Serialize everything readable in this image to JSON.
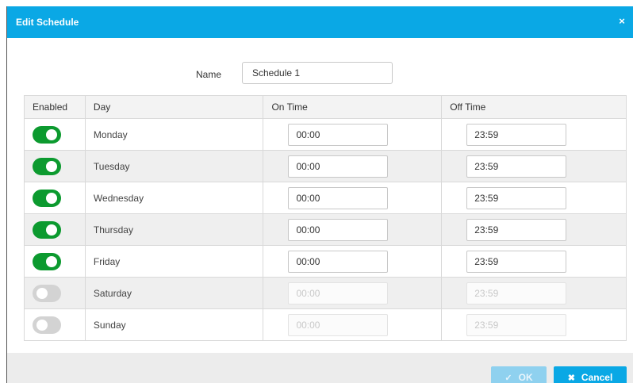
{
  "dialog": {
    "title": "Edit Schedule",
    "close_glyph": "×"
  },
  "name": {
    "label": "Name",
    "value": "Schedule 1"
  },
  "table": {
    "headers": [
      "Enabled",
      "Day",
      "On Time",
      "Off Time"
    ],
    "rows": [
      {
        "enabled": true,
        "day": "Monday",
        "on": "00:00",
        "off": "23:59"
      },
      {
        "enabled": true,
        "day": "Tuesday",
        "on": "00:00",
        "off": "23:59"
      },
      {
        "enabled": true,
        "day": "Wednesday",
        "on": "00:00",
        "off": "23:59"
      },
      {
        "enabled": true,
        "day": "Thursday",
        "on": "00:00",
        "off": "23:59"
      },
      {
        "enabled": true,
        "day": "Friday",
        "on": "00:00",
        "off": "23:59"
      },
      {
        "enabled": false,
        "day": "Saturday",
        "on": "00:00",
        "off": "23:59"
      },
      {
        "enabled": false,
        "day": "Sunday",
        "on": "00:00",
        "off": "23:59"
      }
    ]
  },
  "footer": {
    "ok_label": "OK",
    "ok_icon": "check-icon",
    "ok_glyph": "✓",
    "cancel_label": "Cancel",
    "cancel_icon": "x-icon",
    "cancel_glyph": "✖"
  },
  "colors": {
    "accent": "#0aa8e5",
    "toggle_on": "#0c9a2f",
    "toggle_off": "#d3d3d3",
    "ok_disabled": "#8fd1ef"
  }
}
